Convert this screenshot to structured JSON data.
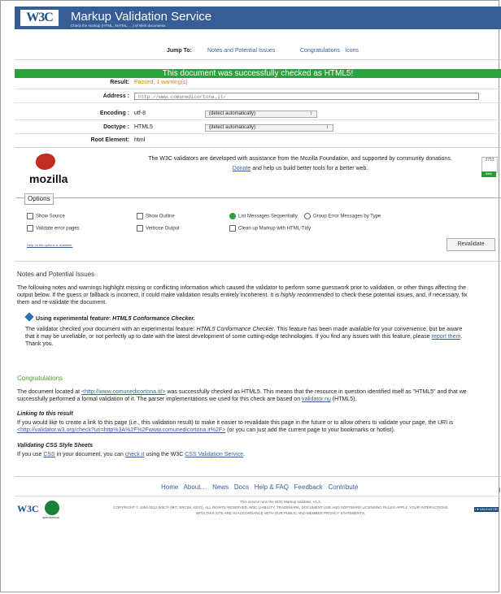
{
  "header": {
    "logo": "W3C",
    "title": "Markup Validation Service",
    "subtitle": "Check the markup (HTML, XHTML, …) of Web documents"
  },
  "jump": {
    "label": "Jump To:",
    "notes": "Notes and Potential Issues",
    "congrats": "Congratulations · Icons"
  },
  "banner": "This document was successfully checked as HTML5!",
  "summary": {
    "result_label": "Result:",
    "result": "Passed, 1 warning(s)",
    "address_label": "Address :",
    "address": "http://www.comunedicortona.it/",
    "encoding_label": "Encoding :",
    "encoding": "utf-8",
    "encoding_select": "(detect automatically)",
    "doctype_label": "Doctype :",
    "doctype": "HTML5",
    "doctype_select": "(detect automatically)",
    "root_label": "Root Element:",
    "root": "html"
  },
  "donation": {
    "text": "The W3C validators are developed with assistance from the Mozilla Foundation, and supported by community donations.",
    "donate": "Donate",
    "rest": " and help us build better tools for a better web.",
    "count": "3753",
    "flattr": "flattr"
  },
  "mozilla": {
    "wordmark": "mozilla"
  },
  "options": {
    "title": "Options",
    "show_source": "Show Source",
    "show_outline": "Show Outline",
    "list_sequential": "List Messages Sequentially",
    "group_error": "Group Error Messages by Type",
    "validate_error_pages": "Validate error pages",
    "verbose_output": "Verbose Output",
    "clean_up": "Clean up Markup with HTML-Tidy",
    "help": "Help on the options is available.",
    "revalidate": "Revalidate"
  },
  "notes": {
    "title": "Notes and Potential Issues",
    "intro1": "The following notes and warnings highlight missing or conflicting information which caused the validator to perform some guesswork prior to validation, or other things affecting the",
    "intro2": "output below. If the guess or fallback is incorrect, it could make validation results entirely incoherent. It is ",
    "intro_em": "highly recommended",
    "intro3": " to check these potential issues, and, if necessary, fix",
    "intro4": "them and re-validate the document.",
    "exp_title_prefix": "Using experimental feature:",
    "exp_title_em": "HTML5 Conformance Checker.",
    "exp1a": "The validator checked your document with an experimental feature: ",
    "exp1_em": "HTML5 Conformance Checker",
    "exp1b": ". This feature has been made available for your convenience, but be aware",
    "exp2a": "that it may be unreliable, or not perfectly up to date with the latest development of some cutting-edge technologies. If you find any issues with this feature, please ",
    "exp2_link": "report them",
    "exp2b": ".",
    "exp3": "Thank you."
  },
  "congrats": {
    "title": "Congratulations",
    "p1a": "The document located at ",
    "p1_link": "<http://www.comunedicortona.it/>",
    "p1b": " was successfully checked as HTML5. This means that the resource in question identified itself as \"HTML5\" and that we",
    "p2a": "successfully performed a formal validation of it. The parser implementations we used for this check are based on ",
    "p2_link": "validator.nu",
    "p2b": " (HTML5).",
    "link_title": "Linking to this result",
    "link1": "If you would like to create a link to this page (i.e., this validation result) to make it easier to revalidate this page in the future or to allow others to validate your page, the URI is",
    "link2_link": "<http://validator.w3.org/check?uri=http%3A%2F%2Fwww.comunedicortona.it%2F>",
    "link2b": " (or you can just add the current page to your bookmarks or hotlist).",
    "css_title": "Validating CSS Style Sheets",
    "css1a": "If you use ",
    "css_link1": "CSS",
    "css1b": " in your document, you can ",
    "css_link2": "check it",
    "css1c": " using the W3C ",
    "css_link3": "CSS Validation Service",
    "css1d": "."
  },
  "footer": {
    "links": [
      "Home",
      "About…",
      "News",
      "Docs",
      "Help & FAQ",
      "Feedback",
      "Contribute"
    ],
    "service": "This service runs the W3C Markup Validator, v1.3.",
    "copyright1": "COPYRIGHT © 1994-2012 W3C® (MIT, ERCIM, KEIO), ALL RIGHTS RESERVED. W3C LIABILITY, TRADEMARK, DOCUMENT USE AND SOFTWARE LICENSING RULES APPLY. YOUR INTERACTIONS",
    "copyright2": "WITH THIS SITE ARE IN ACCORDANCE WITH OUR PUBLIC AND MEMBER PRIVACY STATEMENTS.",
    "w3c": "W3C",
    "opensource": "opensource",
    "badge": "I ♥ VALIDATOR"
  }
}
